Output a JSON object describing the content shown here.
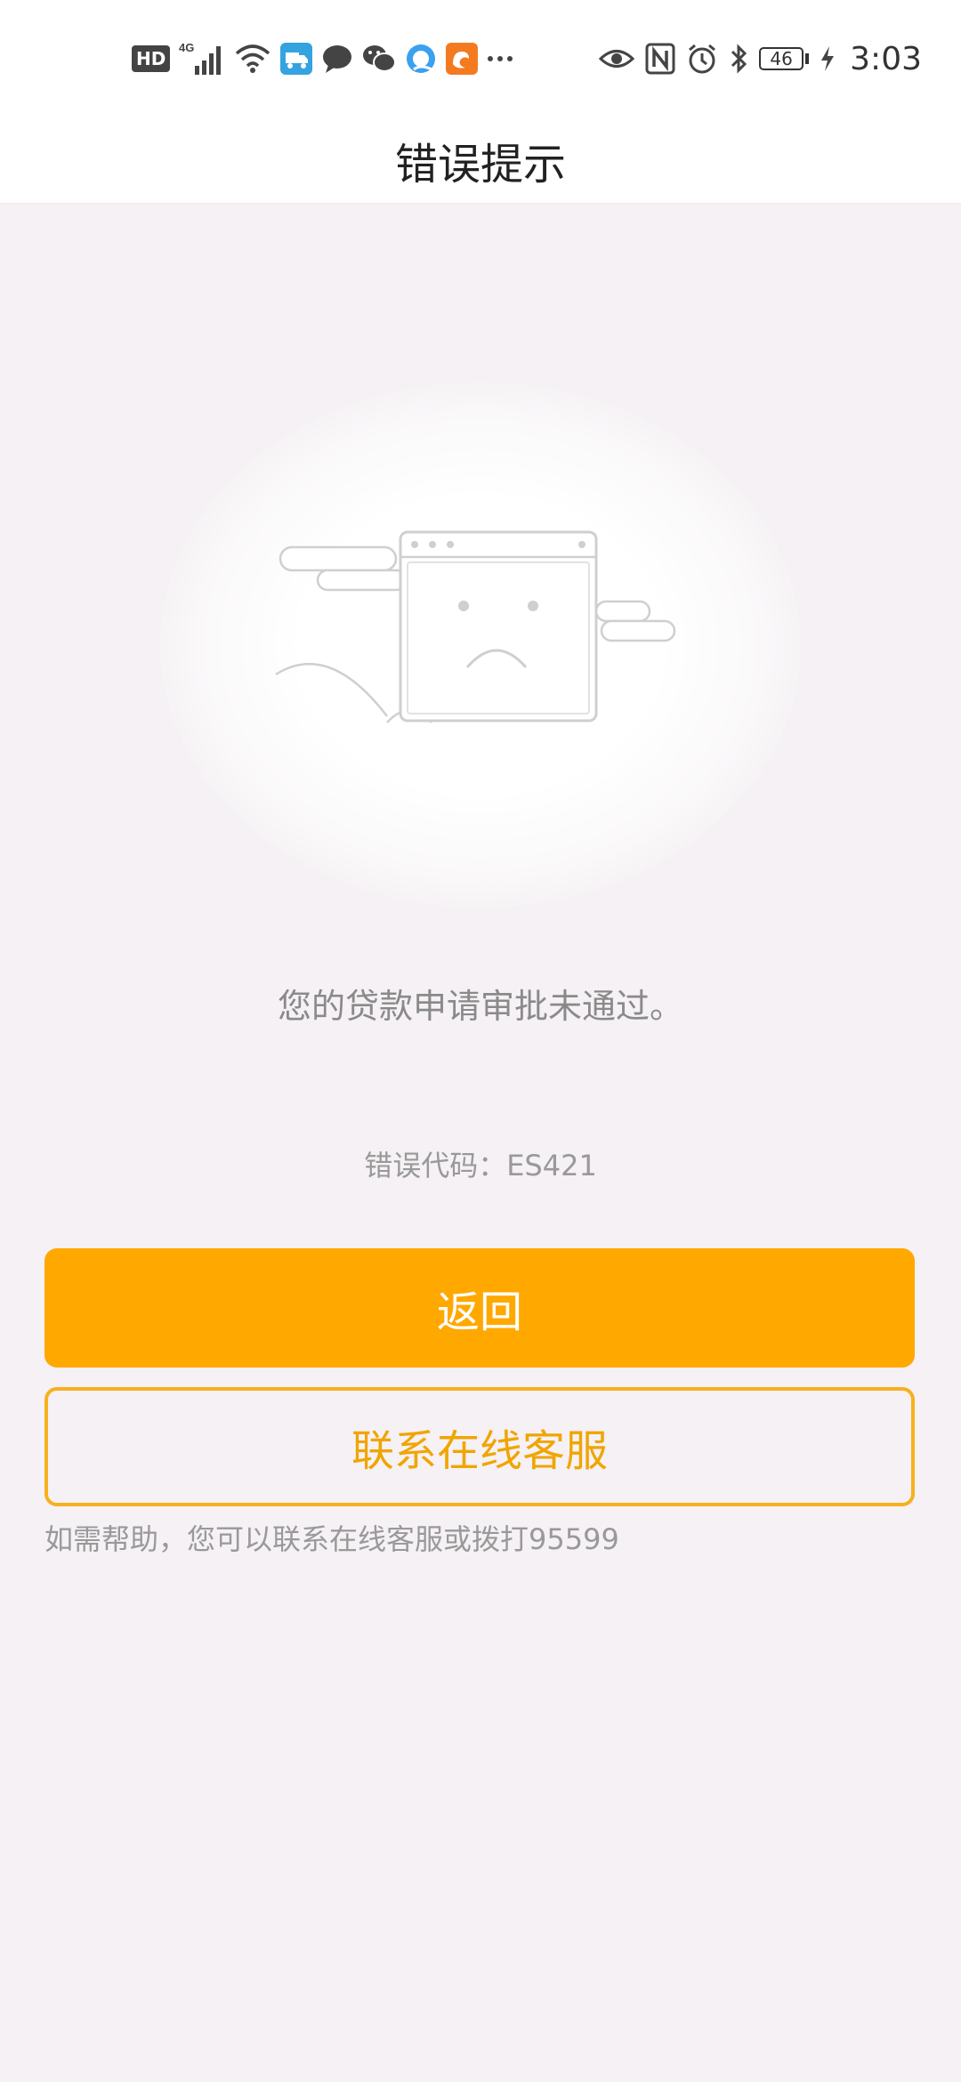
{
  "status_bar": {
    "hd_label": "HD",
    "network_label": "4G",
    "battery_level": "46",
    "time": "3:03",
    "icons": [
      "hd-icon",
      "4g-signal-icon",
      "wifi-icon",
      "delivery-app-icon",
      "message-bubble-icon",
      "wechat-icon",
      "browser-icon",
      "uc-browser-icon",
      "more-dots-icon",
      "eye-icon",
      "nfc-icon",
      "alarm-icon",
      "bluetooth-icon",
      "battery-icon",
      "charging-icon"
    ]
  },
  "header": {
    "title": "错误提示"
  },
  "main": {
    "illustration": "sad-browser-window-icon",
    "message": "您的贷款申请审批未通过。",
    "error_code": "错误代码：ES421",
    "back_label": "返回",
    "service_label": "联系在线客服",
    "help_text": "如需帮助，您可以联系在线客服或拨打95599"
  },
  "colors": {
    "accent": "#ffa800",
    "accent_text": "#f0a500",
    "background": "#f5f1f4"
  }
}
